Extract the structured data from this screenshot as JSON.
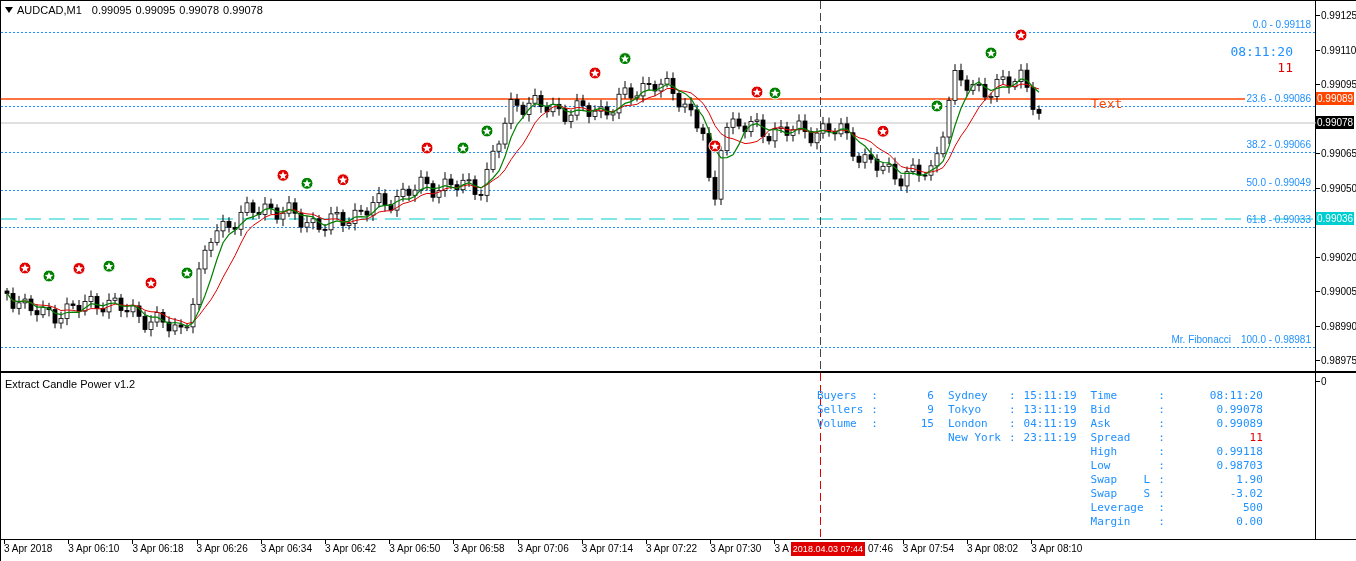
{
  "header": {
    "symbol": "AUDCAD,M1",
    "ohlc": [
      "0.99095",
      "0.99095",
      "0.99078",
      "0.99078"
    ]
  },
  "price_axis": {
    "ticks": [
      "0.99125",
      "0.99110",
      "0.99095",
      "0.99065",
      "0.99050",
      "0.99020",
      "0.99005",
      "0.98990",
      "0.98975"
    ],
    "markers": [
      {
        "kind": "ask",
        "text": "0.99089",
        "color": "#ff4500"
      },
      {
        "kind": "bid",
        "text": "0.99078",
        "color": "#000000"
      },
      {
        "kind": "level",
        "text": "0.99036",
        "color": "#00ced1"
      }
    ]
  },
  "fibonacci": {
    "name": "Mr. Fibonacci",
    "levels": [
      "0.0 - 0.99118",
      "23.6 - 0.99086",
      "38.2 - 0.99066",
      "50.0 - 0.99049",
      "61.8 - 0.99033",
      "100.0 - 0.98981"
    ]
  },
  "overlay": {
    "clock": "08:11:20",
    "spread": "11",
    "text_label": "Text"
  },
  "indicator": {
    "title": "Extract Candle Power v1.2",
    "axis_label": "0",
    "groups": [
      [
        {
          "label": "Buyers",
          "sep": ":",
          "value": "6",
          "alert": false
        },
        {
          "label": "Sellers",
          "sep": ":",
          "value": "9",
          "alert": false
        },
        {
          "label": "Volume",
          "sep": ":",
          "value": "15",
          "alert": false
        }
      ],
      [
        {
          "label": "Sydney",
          "sep": ":",
          "value": "15:11:19",
          "alert": false
        },
        {
          "label": "Tokyo",
          "sep": ":",
          "value": "13:11:19",
          "alert": false
        },
        {
          "label": "London",
          "sep": ":",
          "value": "04:11:19",
          "alert": false
        },
        {
          "label": "New York",
          "sep": ":",
          "value": "23:11:19",
          "alert": false
        }
      ],
      [
        {
          "label": "Time",
          "sep": ":",
          "value": "08:11:20",
          "alert": false
        },
        {
          "label": "Bid",
          "sep": ":",
          "value": "0.99078",
          "alert": false
        },
        {
          "label": "Ask",
          "sep": ":",
          "value": "0.99089",
          "alert": false
        },
        {
          "label": "Spread",
          "sep": ":",
          "value": "11",
          "alert": true
        },
        {
          "label": "High",
          "sep": ":",
          "value": "0.99118",
          "alert": false
        },
        {
          "label": "Low",
          "sep": ":",
          "value": "0.98703",
          "alert": false
        },
        {
          "label": "Swap    L",
          "sep": ":",
          "value": "1.90",
          "alert": false
        },
        {
          "label": "Swap    S",
          "sep": ":",
          "value": "-3.02",
          "alert": false
        },
        {
          "label": "Leverage",
          "sep": ":",
          "value": "500",
          "alert": false
        },
        {
          "label": "Margin",
          "sep": ":",
          "value": "0.00",
          "alert": false
        }
      ]
    ]
  },
  "time_axis": {
    "labels_before": [
      "3 Apr 2018",
      "3 Apr 06:10",
      "3 Apr 06:18",
      "3 Apr 06:26",
      "3 Apr 06:34",
      "3 Apr 06:42",
      "3 Apr 06:50",
      "3 Apr 06:58",
      "3 Apr 07:06",
      "3 Apr 07:14",
      "3 Apr 07:22",
      "3 Apr 07:30",
      "3 A"
    ],
    "crosshair_label": "2018.04.03 07:44",
    "labels_after": [
      "07:46",
      "3 Apr 07:54",
      "3 Apr 08:02",
      "3 Apr 08:10"
    ]
  }
}
